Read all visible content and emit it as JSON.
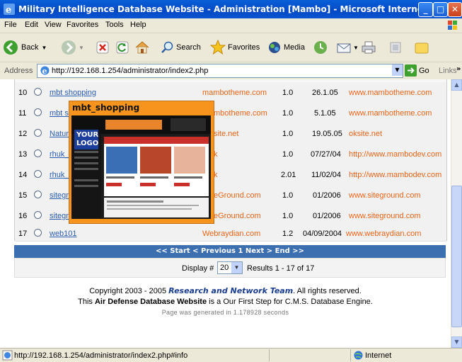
{
  "window": {
    "title": "Military Intelligence Database Website - Administration [Mambo] - Microsoft Internet Explorer",
    "min": "_",
    "max": "□",
    "close": "✕"
  },
  "menu": [
    "File",
    "Edit",
    "View",
    "Favorites",
    "Tools",
    "Help"
  ],
  "toolbar": {
    "back": "Back",
    "search": "Search",
    "favorites": "Favorites",
    "media": "Media"
  },
  "address": {
    "label": "Address",
    "url": "http://192.168.1.254/administrator/index2.php",
    "go": "Go",
    "links": "Links"
  },
  "rows": [
    {
      "num": "10",
      "name": "mbt shopping",
      "author": "mambotheme.com",
      "version": "1.0",
      "date": "26.1.05",
      "site": "www.mambotheme.com"
    },
    {
      "num": "11",
      "name": "mbt si",
      "author": "mbotheme.com",
      "version": "1.0",
      "date": "5.1.05",
      "site": "www.mambotheme.com"
    },
    {
      "num": "12",
      "name": "Nature",
      "author": "site.net",
      "version": "1.0",
      "date": "19.05.05",
      "site": "oksite.net"
    },
    {
      "num": "13",
      "name": "rhuk_",
      "author": "k",
      "version": "1.0",
      "date": "07/27/04",
      "site": "http://www.mambodev.com"
    },
    {
      "num": "14",
      "name": "rhuk_",
      "author": "k",
      "version": "2.01",
      "date": "11/02/04",
      "site": "http://www.mambodev.com"
    },
    {
      "num": "15",
      "name": "sitegro",
      "author": "eGround.com",
      "version": "1.0",
      "date": "01/2006",
      "site": "www.siteground.com"
    },
    {
      "num": "16",
      "name": "sitegro",
      "author": "eGround.com",
      "version": "1.0",
      "date": "01/2006",
      "site": "www.siteground.com"
    },
    {
      "num": "17",
      "name": "web101",
      "author": "Webraydian.com",
      "version": "1.2",
      "date": "04/09/2004",
      "site": "www.webraydian.com"
    }
  ],
  "pager": "<< Start < Previous 1 Next > End >>",
  "display": {
    "label": "Display #",
    "value": "20",
    "results": "Results 1 - 17 of 17"
  },
  "footer": {
    "copyright_pre": "Copyright 2003 - 2005",
    "company": "Research and Network Team",
    "copyright_post": ". All rights reserved.",
    "line2_pre": "This",
    "site_name": "Air Defense Database Website",
    "line2_post": "is a Our First Step for C.M.S. Database Engine.",
    "generated": "Page was generated in 1.178928 seconds"
  },
  "popup": {
    "title": "mbt_shopping",
    "logo_line1": "YOUR",
    "logo_line2": "LOGO"
  },
  "status": {
    "url": "http://192.168.1.254/administrator/index2.php#info",
    "zone": "Internet"
  }
}
